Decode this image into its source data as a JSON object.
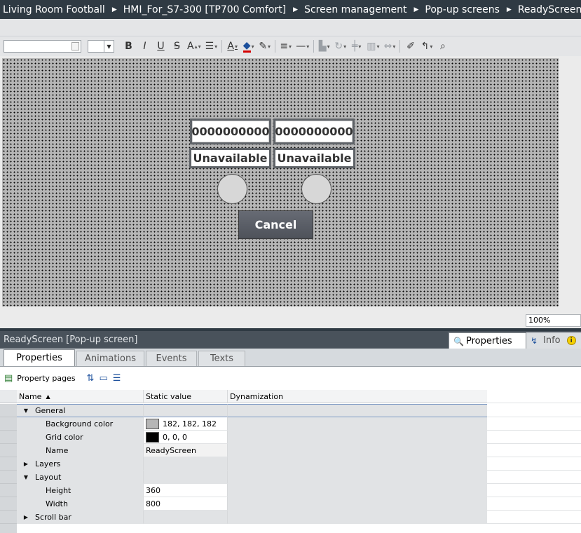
{
  "breadcrumb": {
    "items": [
      "Living Room Football",
      "HMI_For_S7-300 [TP700 Comfort]",
      "Screen management",
      "Pop-up screens",
      "ReadyScreen"
    ]
  },
  "toolbar": {
    "font_name": "",
    "font_size": "",
    "bold_label": "B",
    "italic_label": "I",
    "underline_label": "U",
    "strike_label": "S",
    "font_size_up_label": "A",
    "text_color_label": "A"
  },
  "canvas": {
    "io_field_1": "0000000000",
    "io_field_2": "0000000000",
    "text_field_1": "Unavailable",
    "text_field_2": "Unavailable",
    "cancel_label": "Cancel",
    "background_color": "#b6b6b6",
    "grid_color": "#000000"
  },
  "zoom": "100%",
  "inspector": {
    "title": "ReadyScreen [Pop-up screen]",
    "properties_tab": "Properties",
    "info_tab": "Info",
    "info_badge": "i",
    "subtabs": [
      "Properties",
      "Animations",
      "Events",
      "Texts"
    ],
    "property_pages_label": "Property pages"
  },
  "grid": {
    "headers": {
      "name": "Name",
      "static_value": "Static value",
      "dynamization": "Dynamization"
    },
    "groups": {
      "general": "General",
      "layers": "Layers",
      "layout": "Layout",
      "scroll_bar": "Scroll bar"
    },
    "rows": {
      "background_color": {
        "name": "Background color",
        "value": "182, 182, 182",
        "swatch": "#b6b6b6"
      },
      "grid_color": {
        "name": "Grid color",
        "value": "0, 0, 0",
        "swatch": "#000000"
      },
      "name": {
        "name": "Name",
        "value": "ReadyScreen"
      },
      "height": {
        "name": "Height",
        "value": "360"
      },
      "width": {
        "name": "Width",
        "value": "800"
      }
    }
  }
}
